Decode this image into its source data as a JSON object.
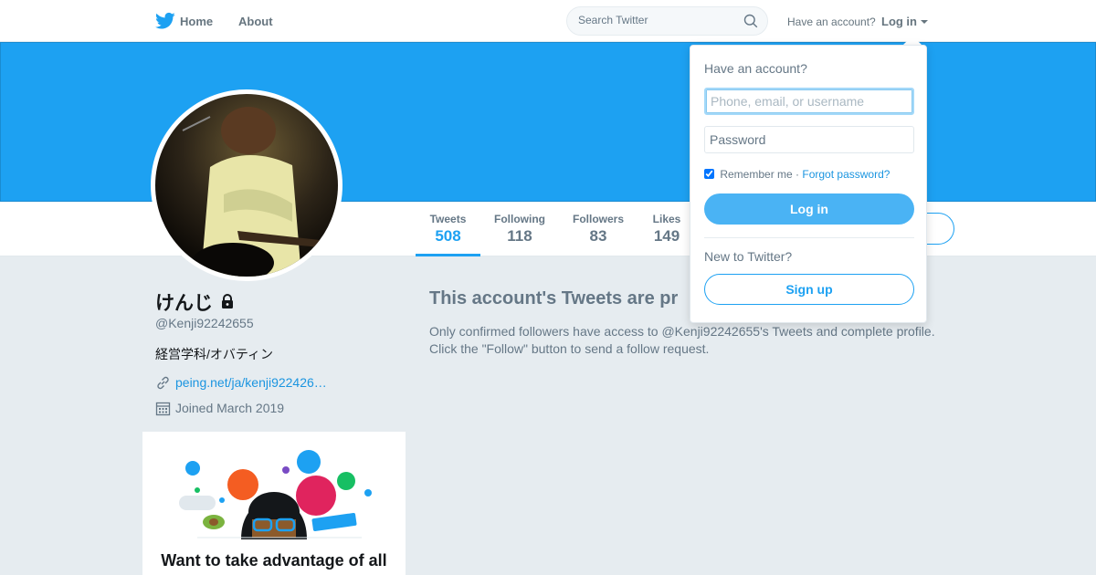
{
  "nav": {
    "logo": "twitter-bird-icon",
    "home_label": "Home",
    "about_label": "About",
    "search_placeholder": "Search Twitter",
    "have_account": "Have an account?",
    "login_label": "Log in"
  },
  "colors": {
    "brand": "#1da1f2",
    "link": "#1b95e0",
    "muted": "#657786"
  },
  "profile": {
    "name": "けんじ",
    "handle": "@Kenji92242655",
    "bio": "経営学科/オバティン",
    "link": "peing.net/ja/kenji922426…",
    "joined": "Joined March 2019",
    "stats": [
      {
        "label": "Tweets",
        "value": "508"
      },
      {
        "label": "Following",
        "value": "118"
      },
      {
        "label": "Followers",
        "value": "83"
      },
      {
        "label": "Likes",
        "value": "149"
      }
    ]
  },
  "main": {
    "protected_title": "This account's Tweets are pr",
    "protected_line1": "Only confirmed followers have access to @Kenji92242655's Tweets and complete profile.",
    "protected_line2": "Click the \"Follow\" button to send a follow request."
  },
  "promo": {
    "title": "Want to take advantage of all"
  },
  "login_dropdown": {
    "heading": "Have an account?",
    "username_placeholder": "Phone, email, or username",
    "password_placeholder": "Password",
    "remember_label": "Remember me",
    "separator": " · ",
    "forgot_label": "Forgot password?",
    "login_button": "Log in",
    "new_to": "New to Twitter?",
    "signup_button": "Sign up"
  }
}
